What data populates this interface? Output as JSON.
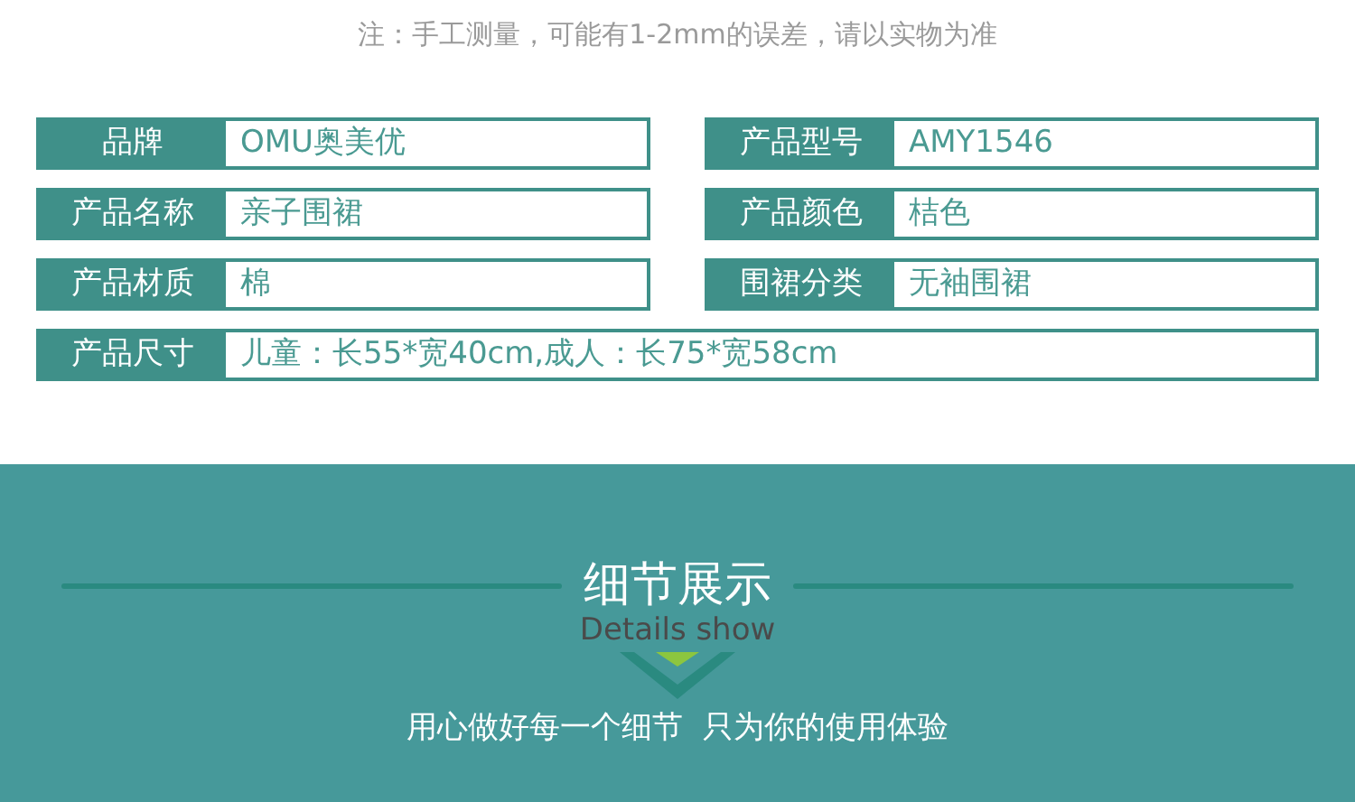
{
  "note": "注：手工测量，可能有1-2mm的误差，请以实物为准",
  "specs": [
    {
      "label": "品牌",
      "value": "OMU奥美优",
      "wide": false
    },
    {
      "label": "产品型号",
      "value": "AMY1546",
      "wide": false
    },
    {
      "label": "产品名称",
      "value": "亲子围裙",
      "wide": false
    },
    {
      "label": "产品颜色",
      "value": "桔色",
      "wide": false
    },
    {
      "label": "产品材质",
      "value": "棉",
      "wide": false
    },
    {
      "label": "围裙分类",
      "value": "无袖围裙",
      "wide": false
    },
    {
      "label": "产品尺寸",
      "value": "儿童：长55*宽40cm,成人：长75*宽58cm",
      "wide": true
    }
  ],
  "section": {
    "title": "细节展示",
    "subtitle": "Details show",
    "tagline": "用心做好每一个细节  只为你的使用体验"
  }
}
